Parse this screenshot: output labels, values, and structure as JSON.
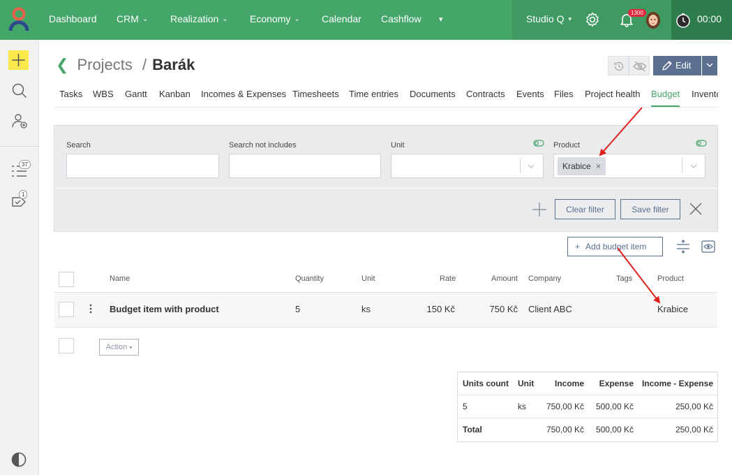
{
  "nav": {
    "items": [
      {
        "label": "Dashboard",
        "dropdown": false
      },
      {
        "label": "CRM",
        "dropdown": true
      },
      {
        "label": "Realization",
        "dropdown": true
      },
      {
        "label": "Economy",
        "dropdown": true
      },
      {
        "label": "Calendar",
        "dropdown": false
      },
      {
        "label": "Cashflow",
        "dropdown": false
      }
    ],
    "studio": "Studio Q",
    "notification_count": "1300",
    "timer": "00:00"
  },
  "sidebar": {
    "tasks_count": "37",
    "approvals_count": "1"
  },
  "header": {
    "section": "Projects",
    "separator": "/",
    "project": "Barák",
    "edit_label": "Edit"
  },
  "tabs": [
    "Tasks",
    "WBS",
    "Gantt",
    "Kanban",
    "Incomes & Expenses",
    "Timesheets",
    "Time entries",
    "Documents",
    "Contracts",
    "Events",
    "Files",
    "Project health",
    "Budget",
    "Invento"
  ],
  "active_tab": "Budget",
  "filter": {
    "search_label": "Search",
    "search_value": "",
    "not_includes_label": "Search not includes",
    "not_includes_value": "",
    "unit_label": "Unit",
    "product_label": "Product",
    "product_chip": "Krabice",
    "clear_label": "Clear filter",
    "save_label": "Save filter"
  },
  "table": {
    "add_label": "Add budget item",
    "headers": {
      "name": "Name",
      "quantity": "Quantity",
      "unit": "Unit",
      "rate": "Rate",
      "amount": "Amount",
      "company": "Company",
      "tags": "Tags",
      "product": "Product"
    },
    "rows": [
      {
        "name": "Budget item with product",
        "quantity": "5",
        "unit": "ks",
        "rate": "150 Kč",
        "amount": "750 Kč",
        "company": "Client ABC",
        "tags": "",
        "product": "Krabice"
      }
    ],
    "action_label": "Action"
  },
  "summary": {
    "headers": {
      "units": "Units count",
      "unit": "Unit",
      "income": "Income",
      "expense": "Expense",
      "diff": "Income - Expense"
    },
    "row": {
      "units": "5",
      "unit": "ks",
      "income": "750,00 Kč",
      "expense": "500,00 Kč",
      "diff": "250,00 Kč"
    },
    "total": {
      "label": "Total",
      "income": "750,00 Kč",
      "expense": "500,00 Kč",
      "diff": "250,00 Kč"
    }
  },
  "colors": {
    "brand_green": "#45a66a",
    "button_slate": "#5b6f8e",
    "annotation_red": "#e0201c",
    "highlight_yellow": "#fbe84a"
  }
}
